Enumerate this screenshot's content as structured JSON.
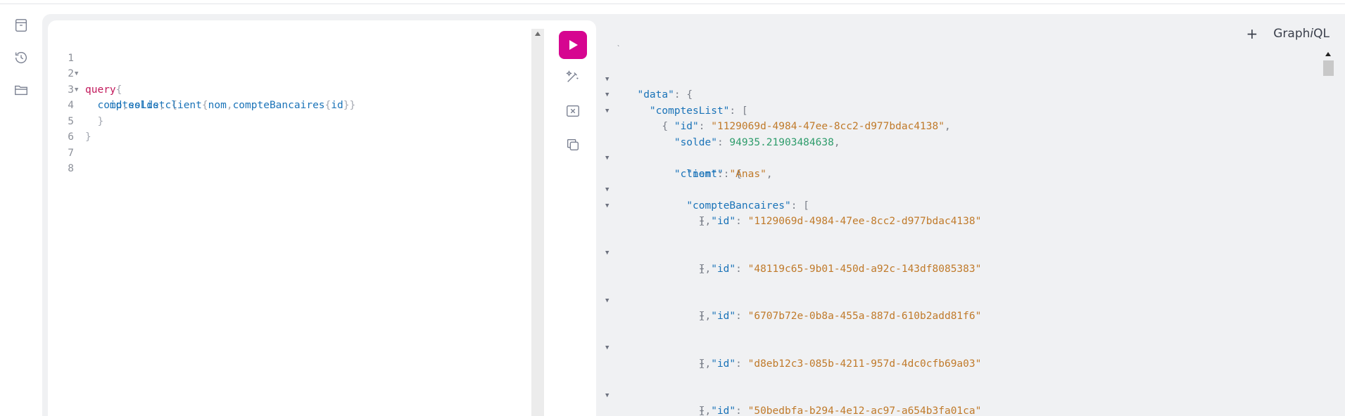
{
  "app": {
    "brand_prefix": "Graph",
    "brand_italic": "i",
    "brand_suffix": "QL",
    "add_tab_label": "+"
  },
  "sidebar": {
    "icons": [
      "documentation-icon",
      "history-icon",
      "collections-icon"
    ]
  },
  "editor": {
    "line_numbers": [
      "1",
      "2",
      "3",
      "4",
      "5",
      "6",
      "7",
      "8"
    ],
    "line1": {
      "kw": "query",
      "brace": "{"
    },
    "line2": {
      "field": "comptesList",
      "brace": "{"
    },
    "line3": {
      "f1": "id",
      "c1": ",",
      "f2": "solde",
      "c2": ",",
      "f3": "client",
      "b1": "{",
      "f4": "nom",
      "c3": ",",
      "f5": "compteBancaires",
      "b2": "{",
      "f6": "id",
      "b3": "}}"
    },
    "line4": {
      "brace": "}"
    },
    "line5": {
      "brace": "}"
    }
  },
  "toolbar": {
    "run_icon": "play-icon",
    "tools": [
      "prettify-icon",
      "merge-fragments-icon",
      "copy-query-icon"
    ]
  },
  "result": {
    "top_fragment": "`",
    "key_data": "\"data\"",
    "key_comptesList": "\"comptesList\"",
    "key_id": "\"id\"",
    "val_id": "\"1129069d-4984-47ee-8cc2-d977bdac4138\"",
    "key_solde": "\"solde\"",
    "val_solde": "94935.21903484638",
    "key_client": "\"client\"",
    "key_nom": "\"nom\"",
    "val_nom": "\"Anas\"",
    "key_compteBancaires": "\"compteBancaires\"",
    "compte_ids": [
      "\"1129069d-4984-47ee-8cc2-d977bdac4138\"",
      "\"48119c65-9b01-450d-a92c-143df8085383\"",
      "\"6707b72e-0b8a-455a-887d-610b2add81f6\"",
      "\"d8eb12c3-085b-4211-957d-4dc0cfb69a03\"",
      "\"50bedbfa-b294-4e12-ac97-a654b3fa01ca\""
    ]
  }
}
